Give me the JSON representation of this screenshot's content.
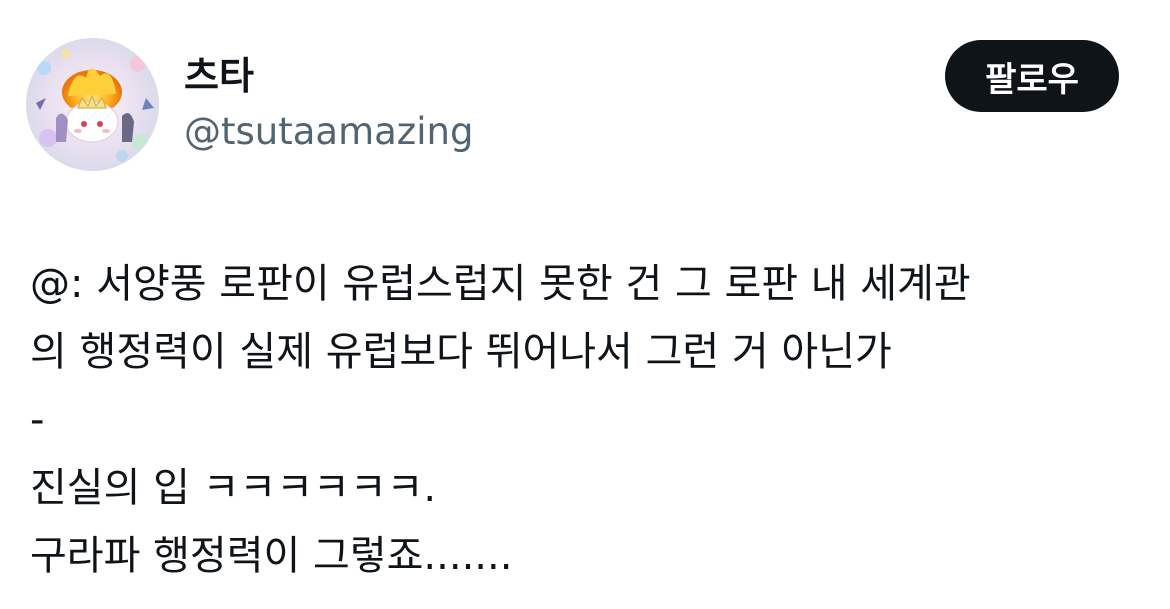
{
  "author": {
    "display_name": "츠타",
    "handle": "@tsutaamazing",
    "avatar_icon": "avatar-illustration"
  },
  "follow_button": {
    "label": "팔로우"
  },
  "tweet": {
    "lines": [
      "@: 서양풍 로판이 유럽스럽지 못한 건 그 로판 내 세계관",
      "의 행정력이 실제 유럽보다 뛰어나서 그런 거 아닌가",
      "-",
      "진실의 입 ㅋㅋㅋㅋㅋㅋ.",
      "구라파 행정력이 그렇죠......."
    ]
  },
  "colors": {
    "text_primary": "#0f1419",
    "text_secondary": "#536471",
    "button_bg": "#0f1419",
    "button_text": "#ffffff"
  }
}
